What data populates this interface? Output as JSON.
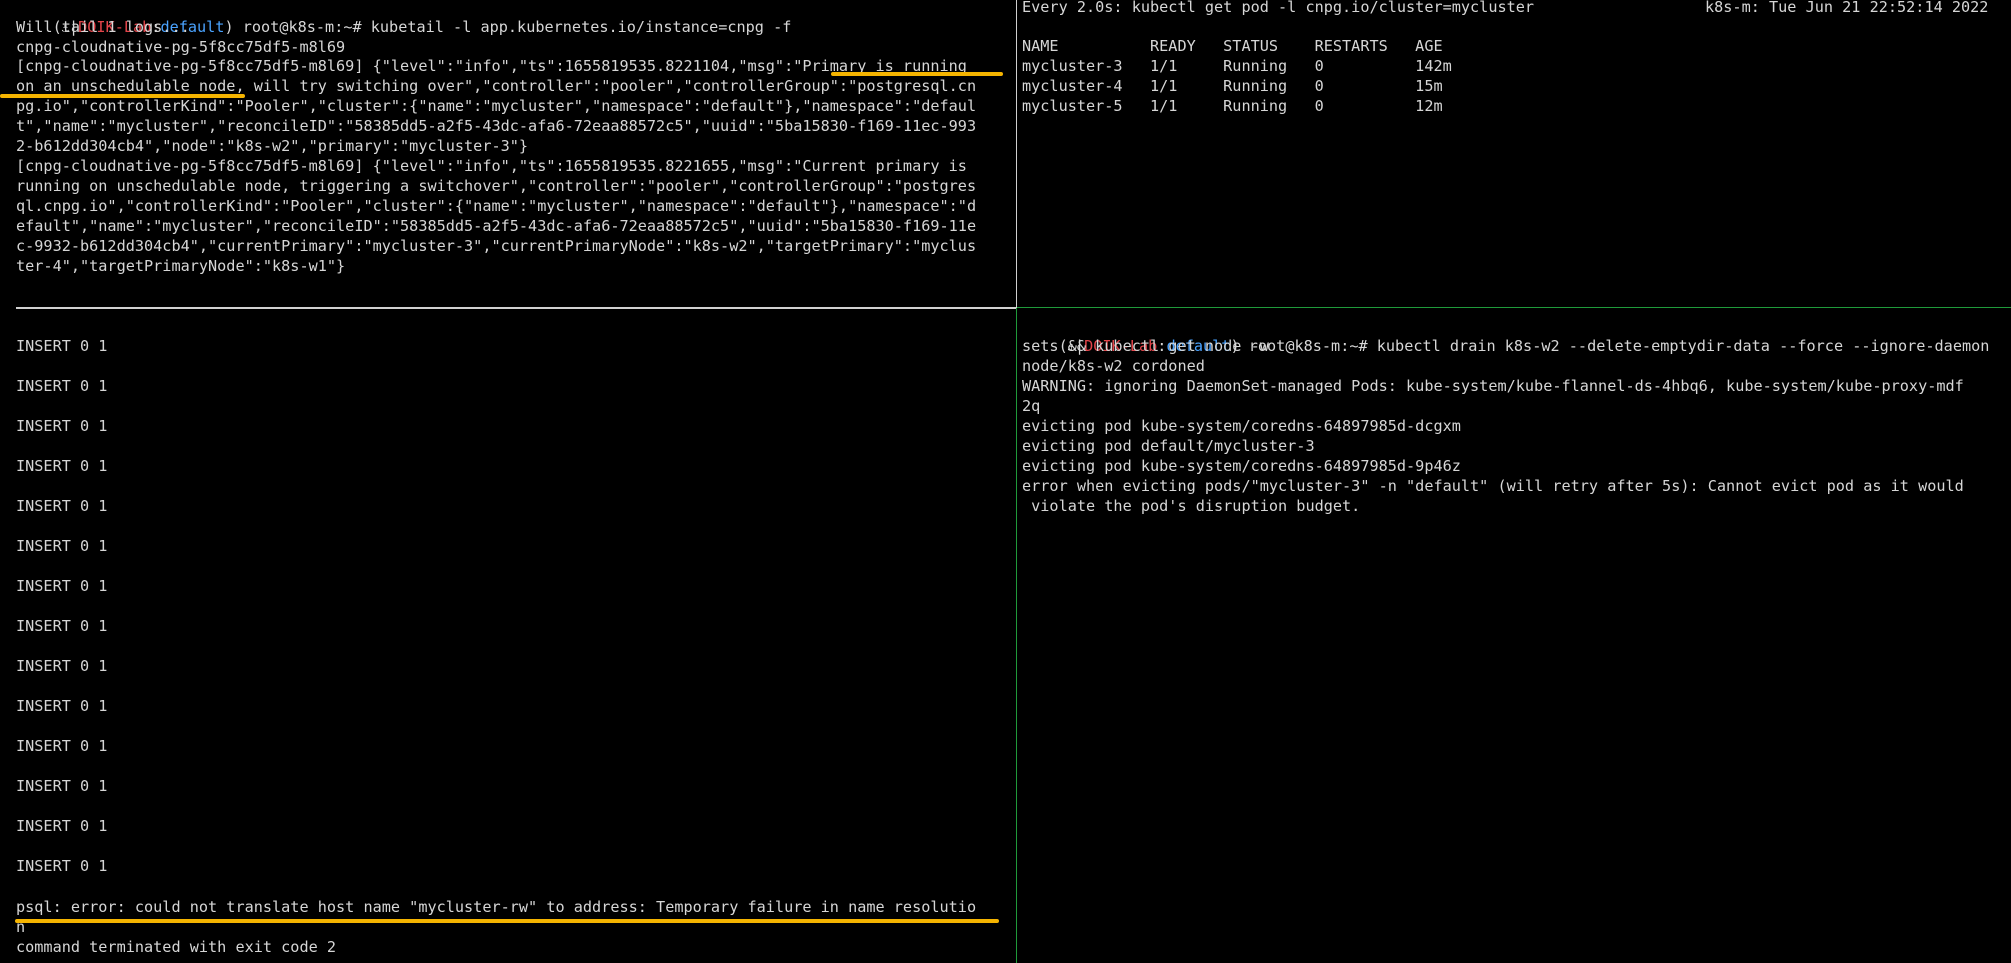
{
  "top_left": {
    "lines": [
      "",
      "Will tail 1 logs...",
      "cnpg-cloudnative-pg-5f8cc75df5-m8l69",
      "[cnpg-cloudnative-pg-5f8cc75df5-m8l69] {\"level\":\"info\",\"ts\":1655819535.8221104,\"msg\":\"Primary is running",
      "on an unschedulable node, will try switching over\",\"controller\":\"pooler\",\"controllerGroup\":\"postgresql.cn",
      "pg.io\",\"controllerKind\":\"Pooler\",\"cluster\":{\"name\":\"mycluster\",\"namespace\":\"default\"},\"namespace\":\"defaul",
      "t\",\"name\":\"mycluster\",\"reconcileID\":\"58385dd5-a2f5-43dc-afa6-72eaa88572c5\",\"uuid\":\"5ba15830-f169-11ec-993",
      "2-b612dd304cb4\",\"node\":\"k8s-w2\",\"primary\":\"mycluster-3\"}",
      "[cnpg-cloudnative-pg-5f8cc75df5-m8l69] {\"level\":\"info\",\"ts\":1655819535.8221655,\"msg\":\"Current primary is",
      "running on unschedulable node, triggering a switchover\",\"controller\":\"pooler\",\"controllerGroup\":\"postgres",
      "ql.cnpg.io\",\"controllerKind\":\"Pooler\",\"cluster\":{\"name\":\"mycluster\",\"namespace\":\"default\"},\"namespace\":\"d",
      "efault\",\"name\":\"mycluster\",\"reconcileID\":\"58385dd5-a2f5-43dc-afa6-72eaa88572c5\",\"uuid\":\"5ba15830-f169-11e",
      "c-9932-b612dd304cb4\",\"currentPrimary\":\"mycluster-3\",\"currentPrimaryNode\":\"k8s-w2\",\"targetPrimary\":\"myclus",
      "ter-4\",\"targetPrimaryNode\":\"k8s-w1\"}"
    ],
    "prompt": {
      "open": "(",
      "icon": "⚓",
      "sep": "|",
      "ctx": "DOIK-Lab",
      "colon": ":",
      "ns": "default",
      "close": ")",
      "cmd": " root@k8s-m:~# kubetail -l app.kubernetes.io/instance=cnpg -f"
    }
  },
  "top_right": {
    "header_left": "Every 2.0s: kubectl get pod -l cnpg.io/cluster=mycluster",
    "header_right": "k8s-m: Tue Jun 21 22:52:14 2022",
    "table_lines": [
      "NAME          READY   STATUS    RESTARTS   AGE",
      "mycluster-3   1/1     Running   0          142m",
      "mycluster-4   1/1     Running   0          15m",
      "mycluster-5   1/1     Running   0          12m"
    ]
  },
  "bottom_left": {
    "lines": [
      "INSERT 0 1",
      "",
      "INSERT 0 1",
      "",
      "INSERT 0 1",
      "",
      "INSERT 0 1",
      "",
      "INSERT 0 1",
      "",
      "INSERT 0 1",
      "",
      "INSERT 0 1",
      "",
      "INSERT 0 1",
      "",
      "INSERT 0 1",
      "",
      "INSERT 0 1",
      "",
      "INSERT 0 1",
      "",
      "INSERT 0 1",
      "",
      "INSERT 0 1",
      "",
      "INSERT 0 1",
      "",
      "psql: error: could not translate host name \"mycluster-rw\" to address: Temporary failure in name resolutio",
      "n",
      "command terminated with exit code 2"
    ]
  },
  "bottom_right": {
    "prompt": {
      "open": "(",
      "icon": "⚓",
      "sep": "|",
      "ctx": "DOIK-Lab",
      "colon": ":",
      "ns": "default",
      "close": ")",
      "cmd": " root@k8s-m:~# kubectl drain k8s-w2 --delete-emptydir-data --force --ignore-daemon"
    },
    "lines": [
      "sets && kubectl get node -w",
      "node/k8s-w2 cordoned",
      "WARNING: ignoring DaemonSet-managed Pods: kube-system/kube-flannel-ds-4hbq6, kube-system/kube-proxy-mdf",
      "2q",
      "evicting pod kube-system/coredns-64897985d-dcgxm",
      "evicting pod default/mycluster-3",
      "evicting pod kube-system/coredns-64897985d-9p46z",
      "error when evicting pods/\"mycluster-3\" -n \"default\" (will retry after 5s): Cannot evict pod as it would",
      " violate the pod's disruption budget."
    ]
  },
  "colors": {
    "highlight": "#f5b400",
    "active_border": "#1f9a3a",
    "divider": "#d0d0d0",
    "context_red": "#e3454a",
    "namespace_blue": "#4aa3ff"
  }
}
